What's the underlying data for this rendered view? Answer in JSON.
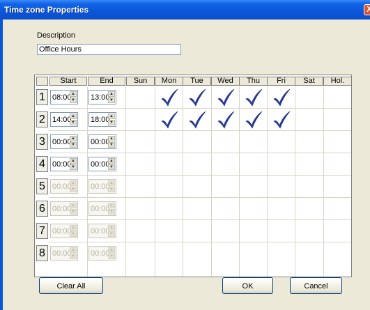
{
  "window": {
    "title": "Time zone Properties",
    "close_glyph": "X"
  },
  "description": {
    "label": "Description",
    "value": "Office Hours"
  },
  "columns": {
    "start": "Start",
    "end": "End",
    "days": [
      "Sun",
      "Mon",
      "Tue",
      "Wed",
      "Thu",
      "Fri",
      "Sat",
      "Hol."
    ]
  },
  "rows": [
    {
      "num": "1",
      "start": "08:00",
      "end": "13:00",
      "enabled": true,
      "days": [
        false,
        true,
        true,
        true,
        true,
        true,
        false,
        false
      ]
    },
    {
      "num": "2",
      "start": "14:00",
      "end": "18:00",
      "enabled": true,
      "days": [
        false,
        true,
        true,
        true,
        true,
        true,
        false,
        false
      ]
    },
    {
      "num": "3",
      "start": "00:00",
      "end": "00:00",
      "enabled": true,
      "days": [
        false,
        false,
        false,
        false,
        false,
        false,
        false,
        false
      ]
    },
    {
      "num": "4",
      "start": "00:00",
      "end": "00:00",
      "enabled": true,
      "days": [
        false,
        false,
        false,
        false,
        false,
        false,
        false,
        false
      ]
    },
    {
      "num": "5",
      "start": "00:00",
      "end": "00:00",
      "enabled": false,
      "days": [
        false,
        false,
        false,
        false,
        false,
        false,
        false,
        false
      ]
    },
    {
      "num": "6",
      "start": "00:00",
      "end": "00:00",
      "enabled": false,
      "days": [
        false,
        false,
        false,
        false,
        false,
        false,
        false,
        false
      ]
    },
    {
      "num": "7",
      "start": "00:00",
      "end": "00:00",
      "enabled": false,
      "days": [
        false,
        false,
        false,
        false,
        false,
        false,
        false,
        false
      ]
    },
    {
      "num": "8",
      "start": "00:00",
      "end": "00:00",
      "enabled": false,
      "days": [
        false,
        false,
        false,
        false,
        false,
        false,
        false,
        false
      ]
    }
  ],
  "buttons": {
    "clear_all": "Clear All",
    "ok": "OK",
    "cancel": "Cancel"
  },
  "icons": {
    "checkmark": "check-icon",
    "spin_up": "▲",
    "spin_down": "▼"
  },
  "colors": {
    "titlebar": "#0a57d6",
    "dialog_bg": "#ece9d8",
    "check": "#2a3f9e"
  }
}
